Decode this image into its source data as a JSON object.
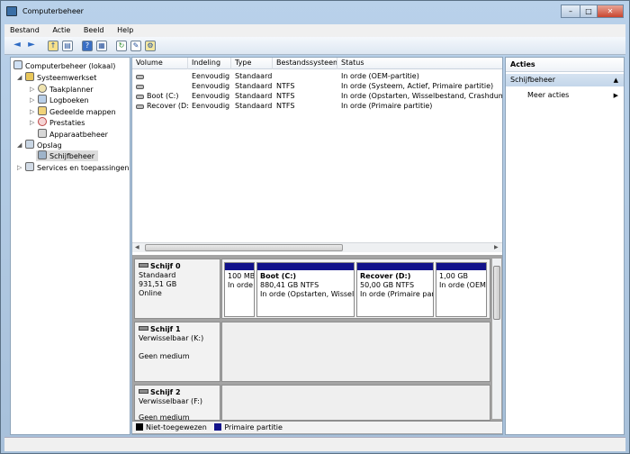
{
  "window": {
    "title": "Computerbeheer",
    "min": "–",
    "max": "□",
    "close": "✕"
  },
  "menu": [
    "Bestand",
    "Actie",
    "Beeld",
    "Help"
  ],
  "toolbar": {
    "back": "◄",
    "forward": "►",
    "up": "↑",
    "showhide": "▤",
    "help": "?",
    "console": "▦",
    "refresh": "↻",
    "properties": "✎",
    "settings": "⚙"
  },
  "tree": {
    "root": "Computerbeheer (lokaal)",
    "systeemwerkset": "Systeemwerkset",
    "taakplanner": "Taakplanner",
    "logboeken": "Logboeken",
    "gedeelde": "Gedeelde mappen",
    "prestaties": "Prestaties",
    "apparaatbeheer": "Apparaatbeheer",
    "opslag": "Opslag",
    "schijfbeheer": "Schijfbeheer",
    "services": "Services en toepassingen"
  },
  "volumes": {
    "headers": [
      "Volume",
      "Indeling",
      "Type",
      "Bestandssysteem",
      "Status"
    ],
    "rows": [
      [
        "",
        "Eenvoudig",
        "Standaard",
        "",
        "In orde (OEM-partitie)"
      ],
      [
        "",
        "Eenvoudig",
        "Standaard",
        "NTFS",
        "In orde (Systeem, Actief, Primaire partitie)"
      ],
      [
        "Boot (C:)",
        "Eenvoudig",
        "Standaard",
        "NTFS",
        "In orde (Opstarten, Wisselbestand, Crashdump, P"
      ],
      [
        "Recover (D:)",
        "Eenvoudig",
        "Standaard",
        "NTFS",
        "In orde (Primaire partitie)"
      ]
    ]
  },
  "disk0": {
    "name": "Schijf 0",
    "type": "Standaard",
    "size": "931,51 GB",
    "state": "Online",
    "partitions": [
      {
        "name": "",
        "size": "100 MB",
        "status": "In orde",
        "share": 0.12
      },
      {
        "name": "Boot  (C:)",
        "size": "880,41 GB NTFS",
        "status": "In orde (Opstarten, Wisselbestand, Crashdump)",
        "share": 0.38
      },
      {
        "name": "Recover  (D:)",
        "size": "50,00 GB NTFS",
        "status": "In orde (Primaire partitie)",
        "share": 0.3
      },
      {
        "name": "",
        "size": "1,00 GB",
        "status": "In orde (OEM-partitie)",
        "share": 0.2
      }
    ]
  },
  "disk1": {
    "name": "Schijf 1",
    "type": "Verwisselbaar (K:)",
    "state": "Geen medium"
  },
  "disk2": {
    "name": "Schijf 2",
    "type": "Verwisselbaar (F:)",
    "state": "Geen medium"
  },
  "legend": {
    "unallocated": "Niet-toegewezen",
    "primary": "Primaire partitie",
    "unallocated_color": "#000000",
    "primary_color": "#12128a"
  },
  "actions": {
    "header": "Acties",
    "section": "Schijfbeheer",
    "more": "Meer acties",
    "collapse": "▲",
    "more_arrow": "▶"
  }
}
